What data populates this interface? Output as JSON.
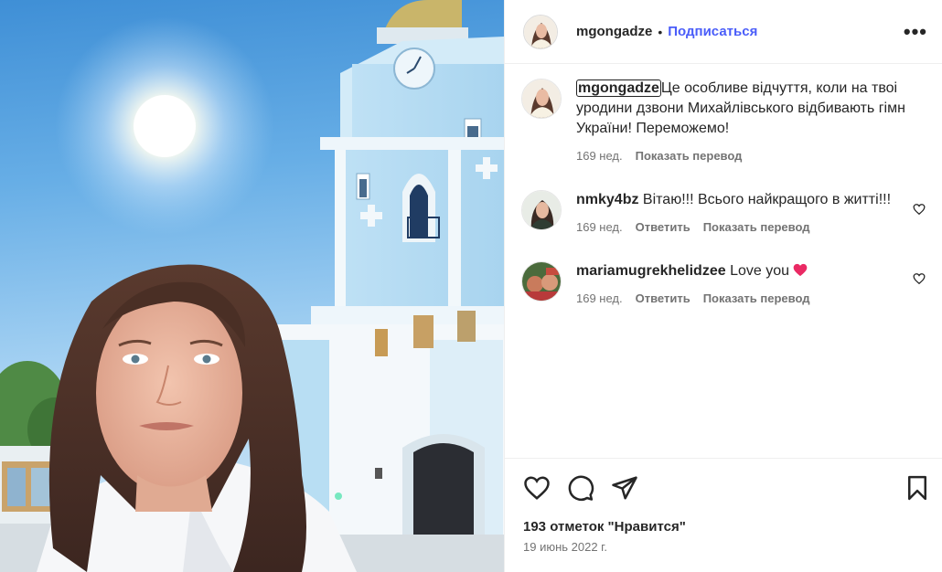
{
  "post": {
    "author": "mgongadze",
    "follow_label": "Подписаться",
    "separator": "•",
    "more_label": "•••"
  },
  "caption": {
    "username": "mgongadze",
    "text": "Це особливе відчуття, коли на твоі уродини дзвони Михайлівського відбивають гімн України! Переможемо!",
    "time": "169 нед.",
    "translate_label": "Показать перевод"
  },
  "comments": [
    {
      "username": "nmky4bz",
      "text": "Вітаю!!! Всього найкращого в житті!!!",
      "time": "169 нед.",
      "reply_label": "Ответить",
      "translate_label": "Показать перевод"
    },
    {
      "username": "mariamugrekhelidzee",
      "text": "Love you",
      "time": "169 нед.",
      "reply_label": "Ответить",
      "translate_label": "Показать перевод"
    }
  ],
  "footer": {
    "likes": "193 отметок \"Нравится\"",
    "date": "19 июнь 2022 г."
  },
  "colors": {
    "follow_blue": "#4a5df9",
    "heart_emoji": "#ea2a64",
    "muted_text": "#737373"
  },
  "icons": [
    "like-icon",
    "comment-icon",
    "share-icon",
    "bookmark-icon",
    "more-options-icon",
    "comment-like-icon",
    "pink-heart-emoji"
  ]
}
